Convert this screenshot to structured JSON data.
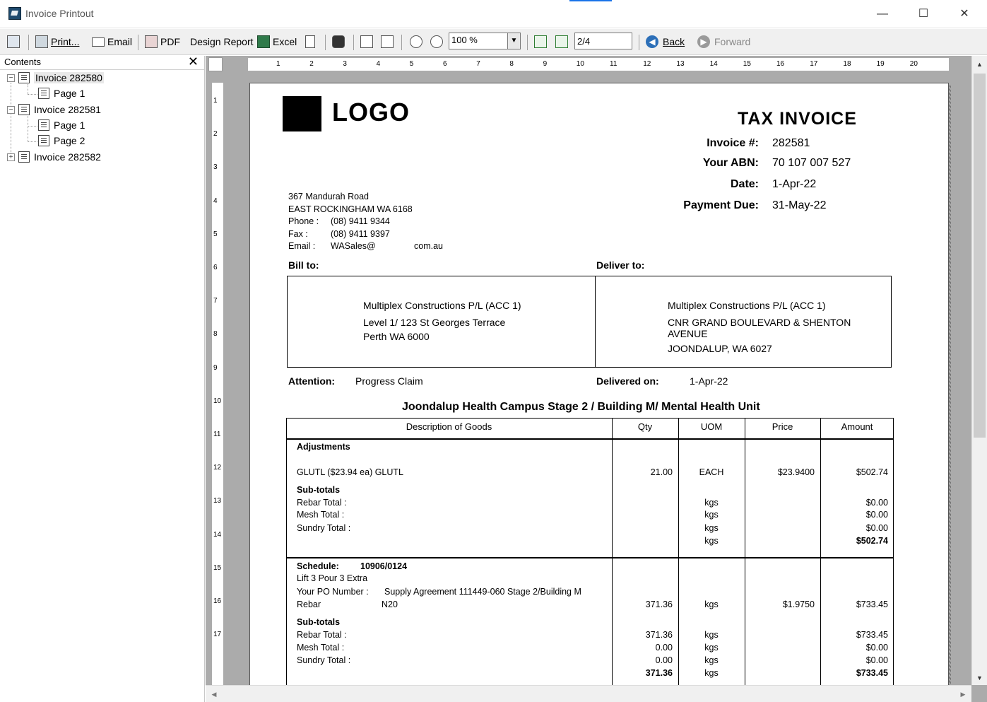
{
  "window": {
    "title": "Invoice Printout",
    "min_glyph": "—",
    "max_glyph": "☐",
    "close_glyph": "✕"
  },
  "toolbar": {
    "print_label": "Print...",
    "email_label": "Email",
    "pdf_label": "PDF",
    "design_report_label": "Design Report",
    "excel_label": "Excel",
    "zoom_value": "100 %",
    "page_value": "2/4",
    "back_label": "Back",
    "forward_label": "Forward"
  },
  "contents": {
    "title": "Contents",
    "close_glyph": "✕",
    "tree": [
      {
        "label": "Invoice 282580",
        "expander": "−",
        "pages": [
          "Page 1"
        ]
      },
      {
        "label": "Invoice 282581",
        "expander": "−",
        "pages": [
          "Page 1",
          "Page 2"
        ]
      },
      {
        "label": "Invoice 282582",
        "expander": "+",
        "pages": []
      }
    ]
  },
  "ruler": {
    "h_marks": [
      "1",
      "2",
      "3",
      "4",
      "5",
      "6",
      "7",
      "8",
      "9",
      "10",
      "11",
      "12",
      "13",
      "14",
      "15",
      "16",
      "17",
      "18",
      "19",
      "20"
    ],
    "v_marks": [
      "1",
      "2",
      "3",
      "4",
      "5",
      "6",
      "7",
      "8",
      "9",
      "10",
      "11",
      "12",
      "13",
      "14",
      "15",
      "16",
      "17"
    ]
  },
  "invoice": {
    "logo": "LOGO",
    "title": "TAX INVOICE",
    "invoice_no_label": "Invoice #:",
    "invoice_no": "282581",
    "abn_label": "Your ABN:",
    "abn": "70 107 007 527",
    "date_label": "Date:",
    "date": "1-Apr-22",
    "due_label": "Payment Due:",
    "due": "31-May-22",
    "sender": {
      "line1": "367 Mandurah Road",
      "line2": "EAST ROCKINGHAM   WA   6168",
      "phone_label": "Phone :",
      "phone": "(08) 9411 9344",
      "fax_label": "Fax :",
      "fax": "(08) 9411 9397",
      "email_label": "Email :",
      "email_user": "WASales@",
      "email_domain": "com.au"
    },
    "bill_to_label": "Bill to:",
    "deliver_to_label": "Deliver to:",
    "bill_to": {
      "name": "Multiplex Constructions P/L (ACC 1)",
      "line1": "Level 1/ 123 St Georges Terrace",
      "line2": "Perth WA 6000"
    },
    "deliver_to": {
      "name": "Multiplex Constructions P/L (ACC 1)",
      "line1": "CNR GRAND BOULEVARD &  SHENTON",
      "line2": "AVENUE",
      "line3": "JOONDALUP, WA 6027"
    },
    "attention_label": "Attention:",
    "attention": "Progress Claim",
    "delivered_on_label": "Delivered on:",
    "delivered_on": "1-Apr-22",
    "project": "Joondalup Health Campus Stage 2 / Building M/ Mental Health Unit",
    "columns": [
      "Description of Goods",
      "Qty",
      "UOM",
      "Price",
      "Amount"
    ],
    "adjustments": {
      "heading": "Adjustments",
      "item_desc": "GLUTL ($23.94 ea) GLUTL",
      "item_qty": "21.00",
      "item_uom": "EACH",
      "item_price": "$23.9400",
      "item_amount": "$502.74",
      "subtotals_label": "Sub-totals",
      "rebar_label": "Rebar Total :",
      "mesh_label": "Mesh Total :",
      "sundry_label": "Sundry Total :",
      "uom_rows": [
        "kgs",
        "kgs",
        "kgs",
        "kgs"
      ],
      "amount_rows": [
        "$0.00",
        "$0.00",
        "$0.00",
        "$502.74"
      ]
    },
    "schedule": {
      "label": "Schedule:",
      "value": "10906/0124",
      "lift": "Lift 3 Pour 3 Extra",
      "po_label": "Your PO Number :",
      "po_value": "Supply Agreement 111449-060 Stage 2/Building M",
      "item_desc": "Rebar",
      "item_code": "N20",
      "item_qty": "371.36",
      "item_uom": "kgs",
      "item_price": "$1.9750",
      "item_amount": "$733.45",
      "subtotals_label": "Sub-totals",
      "rebar_label": "Rebar Total :",
      "mesh_label": "Mesh Total :",
      "sundry_label": "Sundry Total :",
      "qty_rows": [
        "371.36",
        "0.00",
        "0.00",
        "371.36"
      ],
      "uom_rows": [
        "kgs",
        "kgs",
        "kgs",
        "kgs"
      ],
      "amount_rows": [
        "$733.45",
        "$0.00",
        "$0.00",
        "$733.45"
      ]
    }
  }
}
